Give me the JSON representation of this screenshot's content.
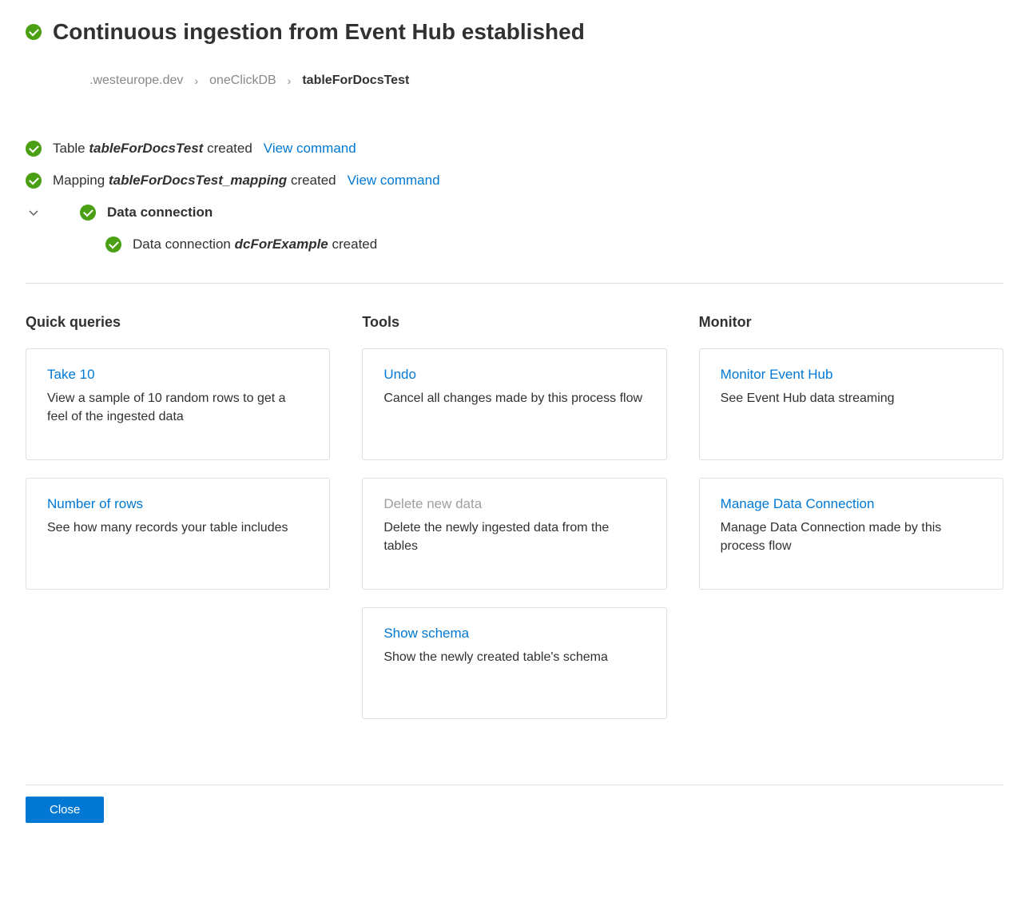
{
  "header": {
    "title": "Continuous ingestion from Event Hub established"
  },
  "breadcrumb": {
    "cluster": ".westeurope.dev",
    "database": "oneClickDB",
    "table": "tableForDocsTest"
  },
  "status": {
    "table": {
      "prefix": "Table",
      "name": "tableForDocsTest",
      "suffix": "created",
      "link": "View command"
    },
    "mapping": {
      "prefix": "Mapping",
      "name": "tableForDocsTest_mapping",
      "suffix": "created",
      "link": "View command"
    },
    "dataConnection": {
      "title": "Data connection",
      "child": {
        "prefix": "Data connection",
        "name": "dcForExample",
        "suffix": "created"
      }
    }
  },
  "columns": {
    "quickQueries": {
      "title": "Quick queries",
      "cards": [
        {
          "title": "Take 10",
          "desc": "View a sample of 10 random rows to get a feel of the ingested data",
          "disabled": false
        },
        {
          "title": "Number of rows",
          "desc": "See how many records your table includes",
          "disabled": false
        }
      ]
    },
    "tools": {
      "title": "Tools",
      "cards": [
        {
          "title": "Undo",
          "desc": "Cancel all changes made by this process flow",
          "disabled": false
        },
        {
          "title": "Delete new data",
          "desc": "Delete the newly ingested data from the tables",
          "disabled": true
        },
        {
          "title": "Show schema",
          "desc": "Show the newly created table's schema",
          "disabled": false
        }
      ]
    },
    "monitor": {
      "title": "Monitor",
      "cards": [
        {
          "title": "Monitor Event Hub",
          "desc": "See Event Hub data streaming",
          "disabled": false
        },
        {
          "title": "Manage Data Connection",
          "desc": "Manage Data Connection made by this process flow",
          "disabled": false
        }
      ]
    }
  },
  "footer": {
    "close": "Close"
  }
}
